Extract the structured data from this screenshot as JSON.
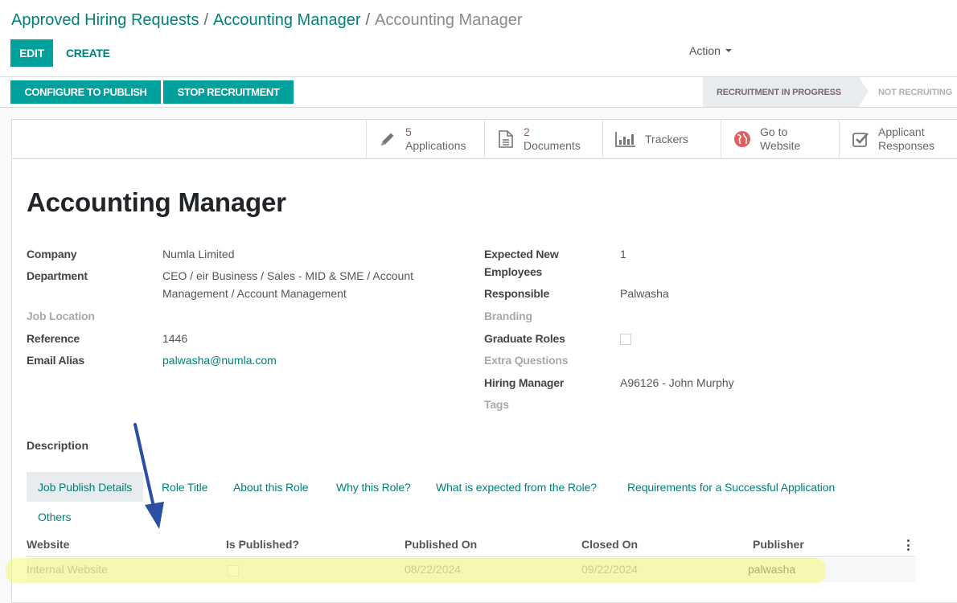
{
  "breadcrumb": [
    {
      "label": "Approved Hiring Requests"
    },
    {
      "label": "Accounting Manager"
    },
    {
      "label": "Accounting Manager"
    }
  ],
  "breadcrumb_separator": "/",
  "control_panel": {
    "edit_label": "EDIT",
    "create_label": "CREATE",
    "action_label": "Action"
  },
  "statusbar": {
    "buttons": [
      {
        "label": "CONFIGURE TO PUBLISH"
      },
      {
        "label": "STOP RECRUITMENT"
      }
    ],
    "stages": [
      {
        "label": "RECRUITMENT IN PROGRESS",
        "active": true
      },
      {
        "label": "NOT RECRUITING",
        "active": false
      }
    ]
  },
  "smart_buttons": [
    {
      "icon": "pencil-icon",
      "count": "5",
      "label": "Applications"
    },
    {
      "icon": "document-icon",
      "count": "2",
      "label": "Documents"
    },
    {
      "icon": "bar-chart-icon",
      "label": "Trackers"
    },
    {
      "icon": "globe-icon",
      "line1": "Go to",
      "line2": "Website",
      "icon_color": "#e0605e"
    },
    {
      "icon": "checkbox-icon",
      "line1": "Applicant",
      "line2": "Responses"
    }
  ],
  "record": {
    "title": "Accounting Manager",
    "left_fields": [
      {
        "label": "Company",
        "value": "Numla Limited"
      },
      {
        "label": "Department",
        "value": "CEO / eir Business / Sales - MID & SME / Account Management / Account Management"
      },
      {
        "label": "Job Location",
        "value": ""
      },
      {
        "label": "Reference",
        "value": "1446"
      },
      {
        "label": "Email Alias",
        "value": "palwasha@numla.com"
      }
    ],
    "right_fields": [
      {
        "label": "Expected New Employees",
        "value": "1"
      },
      {
        "label": "Responsible",
        "value": "Palwasha"
      },
      {
        "label": "Branding",
        "value": ""
      },
      {
        "label": "Graduate Roles",
        "value": false
      },
      {
        "label": "Extra Questions",
        "value": ""
      },
      {
        "label": "Hiring Manager",
        "value": "A96126 - John Murphy"
      },
      {
        "label": "Tags",
        "value": ""
      }
    ],
    "description_label": "Description"
  },
  "tabs": [
    {
      "label": "Job Publish Details",
      "active": true
    },
    {
      "label": "Role Title"
    },
    {
      "label": "About this Role"
    },
    {
      "label": "Why this Role?"
    },
    {
      "label": "What is expected from the Role?"
    },
    {
      "label": "Requirements for a Successful Application"
    },
    {
      "label": "Others"
    }
  ],
  "publish_table": {
    "columns": [
      "Website",
      "Is Published?",
      "Published On",
      "Closed On",
      "Publisher"
    ],
    "rows": [
      {
        "website": "Internal Website",
        "is_published": false,
        "published_on": "08/22/2024",
        "closed_on": "09/22/2024",
        "publisher": "palwasha"
      }
    ]
  },
  "colors": {
    "primary": "#00a09d",
    "link": "#00807a",
    "stat_count": "#875a7b",
    "annotation_arrow": "#2a4fa3",
    "highlight": "#f5f778"
  }
}
